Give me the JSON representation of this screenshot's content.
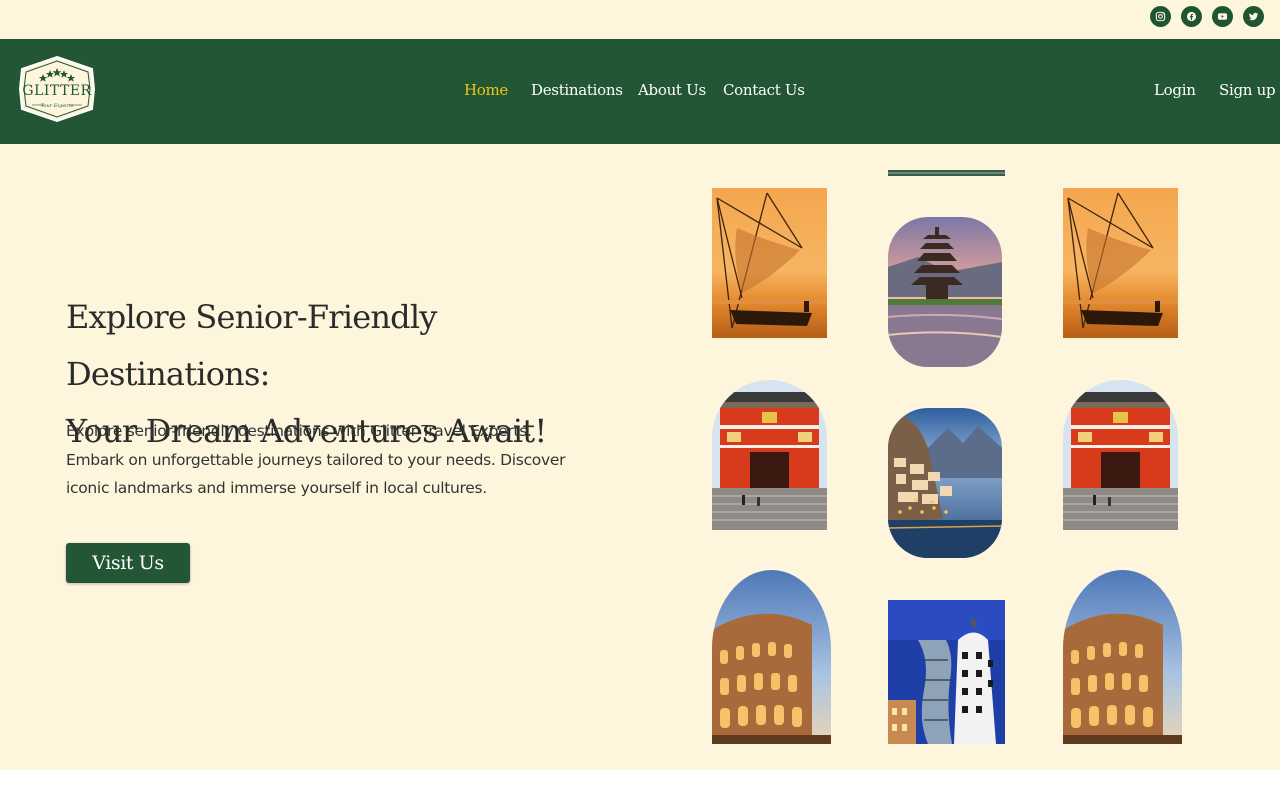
{
  "social": [
    {
      "name": "instagram-icon"
    },
    {
      "name": "facebook-icon"
    },
    {
      "name": "youtube-icon"
    },
    {
      "name": "twitter-icon"
    }
  ],
  "brand": {
    "name": "GLITTER",
    "tagline": "Tour Experts"
  },
  "nav": {
    "links": [
      "Home",
      "Destinations",
      "About Us",
      "Contact Us"
    ],
    "active": "Home",
    "login": "Login",
    "signup": "Sign up"
  },
  "hero": {
    "headline_line1": "Explore Senior-Friendly Destinations:",
    "headline_line2": "Your Dream Adventures Await!",
    "description": "Explore senior-friendly destinations with Glitter Travel Experts. Embark on unforgettable journeys tailored to your needs. Discover iconic landmarks and immerse yourself in local cultures.",
    "cta": "Visit Us"
  },
  "gallery": [
    "fishing-net-sunset-photo",
    "bali-temple-photo",
    "fishing-net-sunset-photo",
    "japanese-shrine-gate-photo",
    "amalfi-coast-photo",
    "japanese-shrine-gate-photo",
    "colosseum-photo",
    "dancing-house-photo",
    "colosseum-photo"
  ],
  "colors": {
    "primary_green": "#225634",
    "cream": "#fdf6dd",
    "active_link": "#f0c419",
    "text": "#2b2b2b"
  }
}
